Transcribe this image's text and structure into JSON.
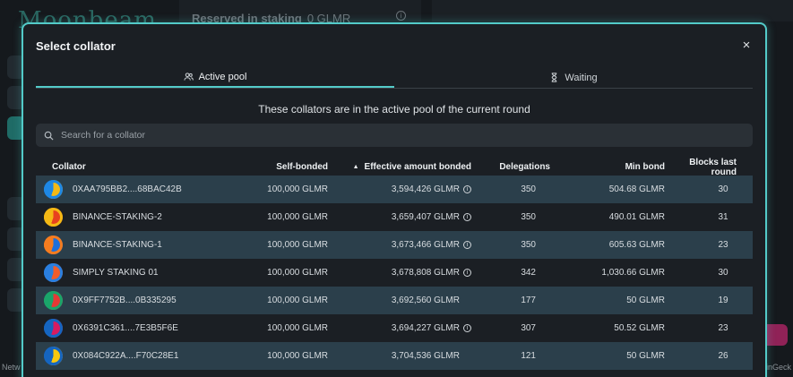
{
  "background": {
    "logo": "Moonbeam",
    "staking_label": "Reserved in staking",
    "staking_value": "0 GLMR",
    "footer_left": "Netw",
    "footer_right": "inGeck"
  },
  "modal": {
    "title": "Select collator",
    "close_symbol": "×",
    "tabs": [
      {
        "label": "Active pool",
        "icon": "users-icon",
        "active": true
      },
      {
        "label": "Waiting",
        "icon": "hourglass-icon",
        "active": false
      }
    ],
    "subtitle": "These collators are in the active pool of the current round",
    "search": {
      "placeholder": "Search for a collator",
      "value": ""
    },
    "table": {
      "headers": {
        "collator": "Collator",
        "self_bonded": "Self-bonded",
        "effective": "Effective amount bonded",
        "delegations": "Delegations",
        "min_bond": "Min bond",
        "blocks": "Blocks last round"
      },
      "rows": [
        {
          "name": "0XAA795BB2....68BAC42B",
          "self": "100,000 GLMR",
          "effective": "3,594,426 GLMR",
          "info": true,
          "delegations": "350",
          "min_bond": "504.68 GLMR",
          "blocks": "30",
          "avatar_colors": [
            "#f5b915",
            "#1e88e5"
          ]
        },
        {
          "name": "BINANCE-STAKING-2",
          "self": "100,000 GLMR",
          "effective": "3,659,407 GLMR",
          "info": true,
          "delegations": "350",
          "min_bond": "490.01 GLMR",
          "blocks": "31",
          "avatar_colors": [
            "#e8421e",
            "#f5b915"
          ]
        },
        {
          "name": "BINANCE-STAKING-1",
          "self": "100,000 GLMR",
          "effective": "3,673,466 GLMR",
          "info": true,
          "delegations": "350",
          "min_bond": "605.63 GLMR",
          "blocks": "23",
          "avatar_colors": [
            "#1e6fd9",
            "#f57c1f"
          ]
        },
        {
          "name": "SIMPLY STAKING 01",
          "self": "100,000 GLMR",
          "effective": "3,678,808 GLMR",
          "info": true,
          "delegations": "342",
          "min_bond": "1,030.66 GLMR",
          "blocks": "30",
          "avatar_colors": [
            "#f25c2a",
            "#2a7fe0"
          ]
        },
        {
          "name": "0X9FF7752B....0B335295",
          "self": "100,000 GLMR",
          "effective": "3,692,560 GLMR",
          "info": false,
          "delegations": "177",
          "min_bond": "50 GLMR",
          "blocks": "19",
          "avatar_colors": [
            "#e53935",
            "#1aa56a"
          ]
        },
        {
          "name": "0X6391C361....7E3B5F6E",
          "self": "100,000 GLMR",
          "effective": "3,694,227 GLMR",
          "info": true,
          "delegations": "307",
          "min_bond": "50.52 GLMR",
          "blocks": "23",
          "avatar_colors": [
            "#d81b60",
            "#1565c0"
          ]
        },
        {
          "name": "0X084C922A....F70C28E1",
          "self": "100,000 GLMR",
          "effective": "3,704,536 GLMR",
          "info": false,
          "delegations": "121",
          "min_bond": "50 GLMR",
          "blocks": "26",
          "avatar_colors": [
            "#f9c80e",
            "#1565c0"
          ]
        }
      ]
    }
  }
}
